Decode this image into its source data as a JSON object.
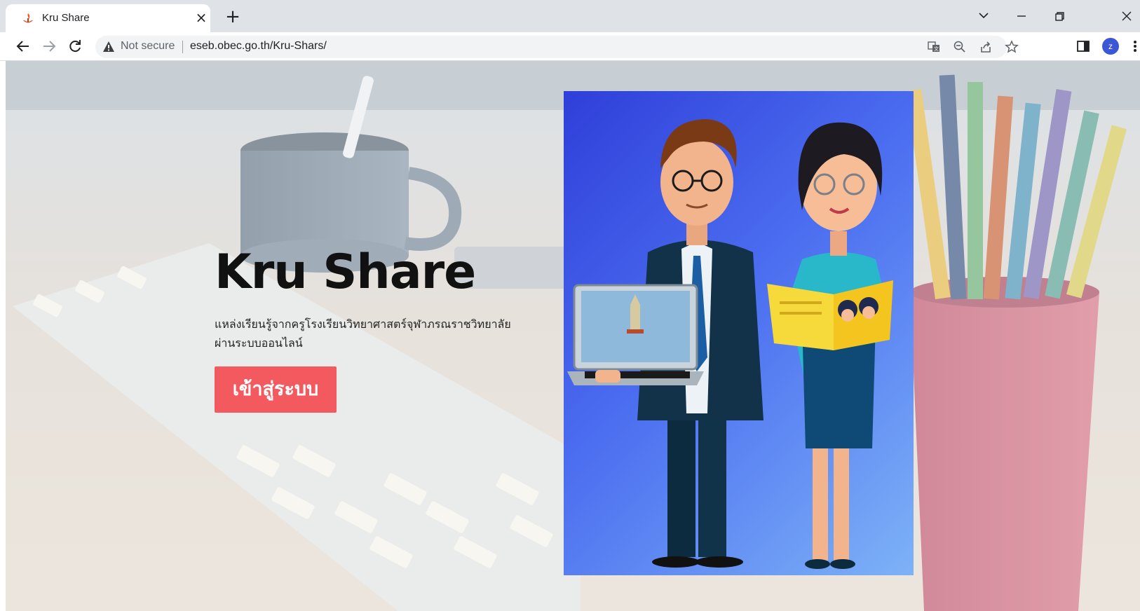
{
  "browser": {
    "tab_title": "Kru Share",
    "tab_close": "×",
    "new_tab": "+",
    "security_label": "Not secure",
    "url": "eseb.obec.go.th/Kru-Shars/",
    "profile_initial": "z"
  },
  "hero": {
    "title": "Kru Share",
    "description_line1": "แหล่งเรียนรู้จากครูโรงเรียนวิทยาศาสตร์จุฬาภรณราชวิทยาลัย",
    "description_line2": "ผ่านระบบออนไลน์",
    "login_button": "เข้าสู่ระบบ"
  },
  "colors": {
    "accent_button": "#f25a5f",
    "illustration_blue": "#3f56e3",
    "tabstrip": "#dfe3e8"
  },
  "icons": [
    "favicon-icon",
    "back-arrow-icon",
    "forward-arrow-icon",
    "reload-icon",
    "warning-icon",
    "translate-icon",
    "zoom-out-icon",
    "share-icon",
    "bookmark-star-icon",
    "side-panel-icon",
    "menu-dots-icon"
  ]
}
